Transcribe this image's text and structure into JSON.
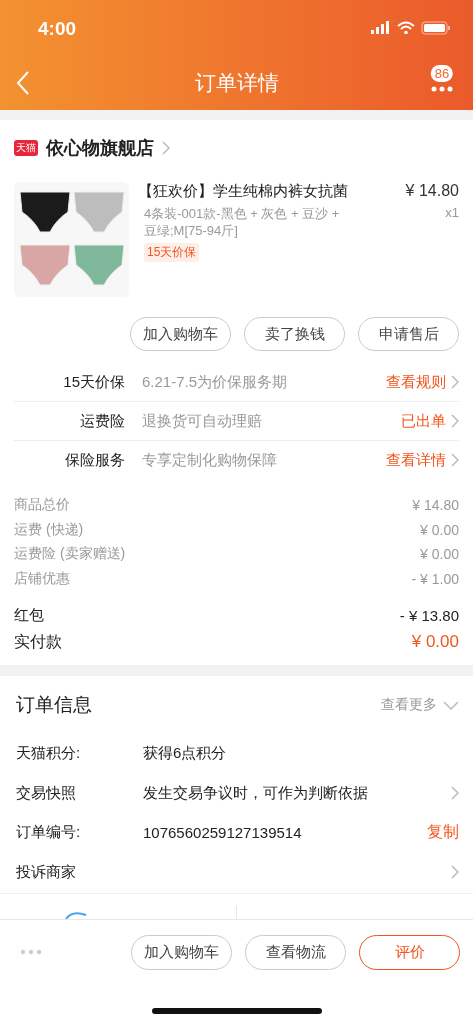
{
  "status_bar": {
    "time": "4:00"
  },
  "nav": {
    "title": "订单详情",
    "badge": "86"
  },
  "store": {
    "badge": "天猫",
    "name": "依心物旗舰店"
  },
  "product": {
    "title": "【狂欢价】学生纯棉内裤女抗菌",
    "sku": "4条装-001款-黑色 + 灰色 + 豆沙 + 豆绿;M[75-94斤]",
    "tag": "15天价保",
    "price": "¥ 14.80",
    "quantity": "x1"
  },
  "item_actions": [
    "加入购物车",
    "卖了换钱",
    "申请售后"
  ],
  "services": [
    {
      "label": "15天价保",
      "desc": "6.21-7.5为价保服务期",
      "action": "查看规则"
    },
    {
      "label": "运费险",
      "desc": "退换货可自动理赔",
      "action": "已出单"
    },
    {
      "label": "保险服务",
      "desc": "专享定制化购物保障",
      "action": "查看详情"
    }
  ],
  "fees": [
    {
      "label": "商品总价",
      "value": "¥ 14.80"
    },
    {
      "label": "运费 (快递)",
      "value": "¥ 0.00"
    },
    {
      "label": "运费险 (卖家赠送)",
      "value": "¥ 0.00"
    },
    {
      "label": "店铺优惠",
      "value": "- ¥ 1.00"
    }
  ],
  "red_packet": {
    "label": "红包",
    "value": "- ¥ 13.80"
  },
  "paid": {
    "label": "实付款",
    "value": "¥ 0.00"
  },
  "order_info": {
    "title": "订单信息",
    "more": "查看更多",
    "rows": [
      {
        "kind": "plain",
        "label": "天猫积分:",
        "value": "获得6点积分"
      },
      {
        "kind": "link",
        "label": "交易快照",
        "value": "发生交易争议时，可作为判断依据"
      },
      {
        "kind": "copy",
        "label": "订单编号:",
        "value": "1076560259127139514",
        "action": "复制"
      },
      {
        "kind": "link",
        "label": "投诉商家"
      }
    ]
  },
  "bottom_bar": {
    "buttons": [
      {
        "label": "加入购物车",
        "primary": false
      },
      {
        "label": "查看物流",
        "primary": false
      },
      {
        "label": "评价",
        "primary": true
      }
    ]
  }
}
